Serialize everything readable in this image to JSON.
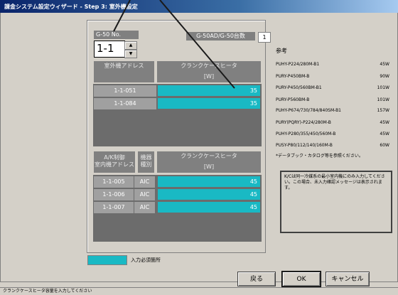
{
  "window": {
    "title": "課金システム設定ウィザード - Step 3: 室外機設定"
  },
  "g50": {
    "no_label": "G-50 No.",
    "selected_no": "1-1",
    "count_label": "G-50AD/G-50台数",
    "count_value": "1"
  },
  "outdoor_table": {
    "headers": {
      "address": "室外機アドレス",
      "crankcase_heater": "クランクケースヒータ",
      "unit": "[W]"
    },
    "rows": [
      {
        "address": "1-1-051",
        "value": "35"
      },
      {
        "address": "1-1-084",
        "value": "35"
      }
    ]
  },
  "indoor_table": {
    "headers": {
      "address": "A/K制御\n室内機アドレス",
      "model_type": "機器\n種別",
      "crankcase_heater": "クランクケースヒータ",
      "unit": "[W]"
    },
    "rows": [
      {
        "address": "1-1-005",
        "type": "AIC",
        "value": "45"
      },
      {
        "address": "1-1-006",
        "type": "AIC",
        "value": "45"
      },
      {
        "address": "1-1-007",
        "type": "AIC",
        "value": "45"
      }
    ]
  },
  "reference": {
    "title": "参考",
    "items": [
      {
        "model": "PUHY-P224/280M-B1",
        "watt": "45W"
      },
      {
        "model": "PURY-P450BM-B",
        "watt": "90W"
      },
      {
        "model": "PURY-P450/560BM-B1",
        "watt": "101W"
      },
      {
        "model": "PURY-P560BM-B",
        "watt": "101W"
      },
      {
        "model": "PUHY-P674/730/784/840SM-B1",
        "watt": "157W"
      },
      {
        "model": "PURY(PQRY)-P224/280M-B",
        "watt": "45W"
      },
      {
        "model": "PUHY-P280/355/450/560M-B",
        "watt": "45W"
      },
      {
        "model": "PUSY-P80/112/140/160M-B",
        "watt": "60W"
      }
    ],
    "note": "*データブック・カタログ等を参照ください。"
  },
  "notice": "K/Cは同一冷媒系の最小室内機にのみ入力してください。この場合、未入力確認メッセージは表示されます。",
  "legend": {
    "required_label": "入力必須箇所"
  },
  "buttons": {
    "back": "戻る",
    "ok": "OK",
    "cancel": "キャンセル"
  },
  "statusbar": "クランクケースヒータ容量を入力してください",
  "colors": {
    "required_cell": "#19b9c4",
    "title_bar": "#0a246a",
    "header_gray": "#808080"
  }
}
